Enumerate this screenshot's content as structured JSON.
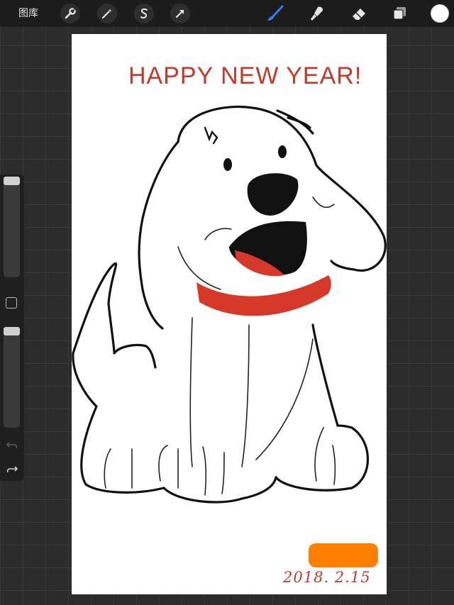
{
  "toolbar": {
    "gallery_label": "图库",
    "left_tools": [
      {
        "name": "actions",
        "icon": "wrench-icon"
      },
      {
        "name": "adjustments",
        "icon": "magic-wand-icon"
      },
      {
        "name": "selection",
        "icon": "selection-s-icon"
      },
      {
        "name": "transform",
        "icon": "arrow-icon"
      }
    ],
    "right_tools": [
      {
        "name": "brush",
        "icon": "brush-icon",
        "active": true
      },
      {
        "name": "smudge",
        "icon": "smudge-icon"
      },
      {
        "name": "eraser",
        "icon": "eraser-icon"
      },
      {
        "name": "layers",
        "icon": "layers-icon"
      }
    ],
    "current_color": "#ffffff",
    "active_color": "#3d7bf2"
  },
  "sidebar": {
    "brush_size_level": 1.0,
    "opacity_level": 1.0,
    "undo_icon": "undo-icon",
    "redo_icon": "redo-icon"
  },
  "artwork": {
    "headline": "HAPPY NEW YEAR!",
    "signature_date": "2018. 2.15",
    "ink_color": "#111111",
    "text_color": "#c23a2a",
    "collar_color": "#d6392a",
    "redaction_color": "#ff7f00"
  }
}
